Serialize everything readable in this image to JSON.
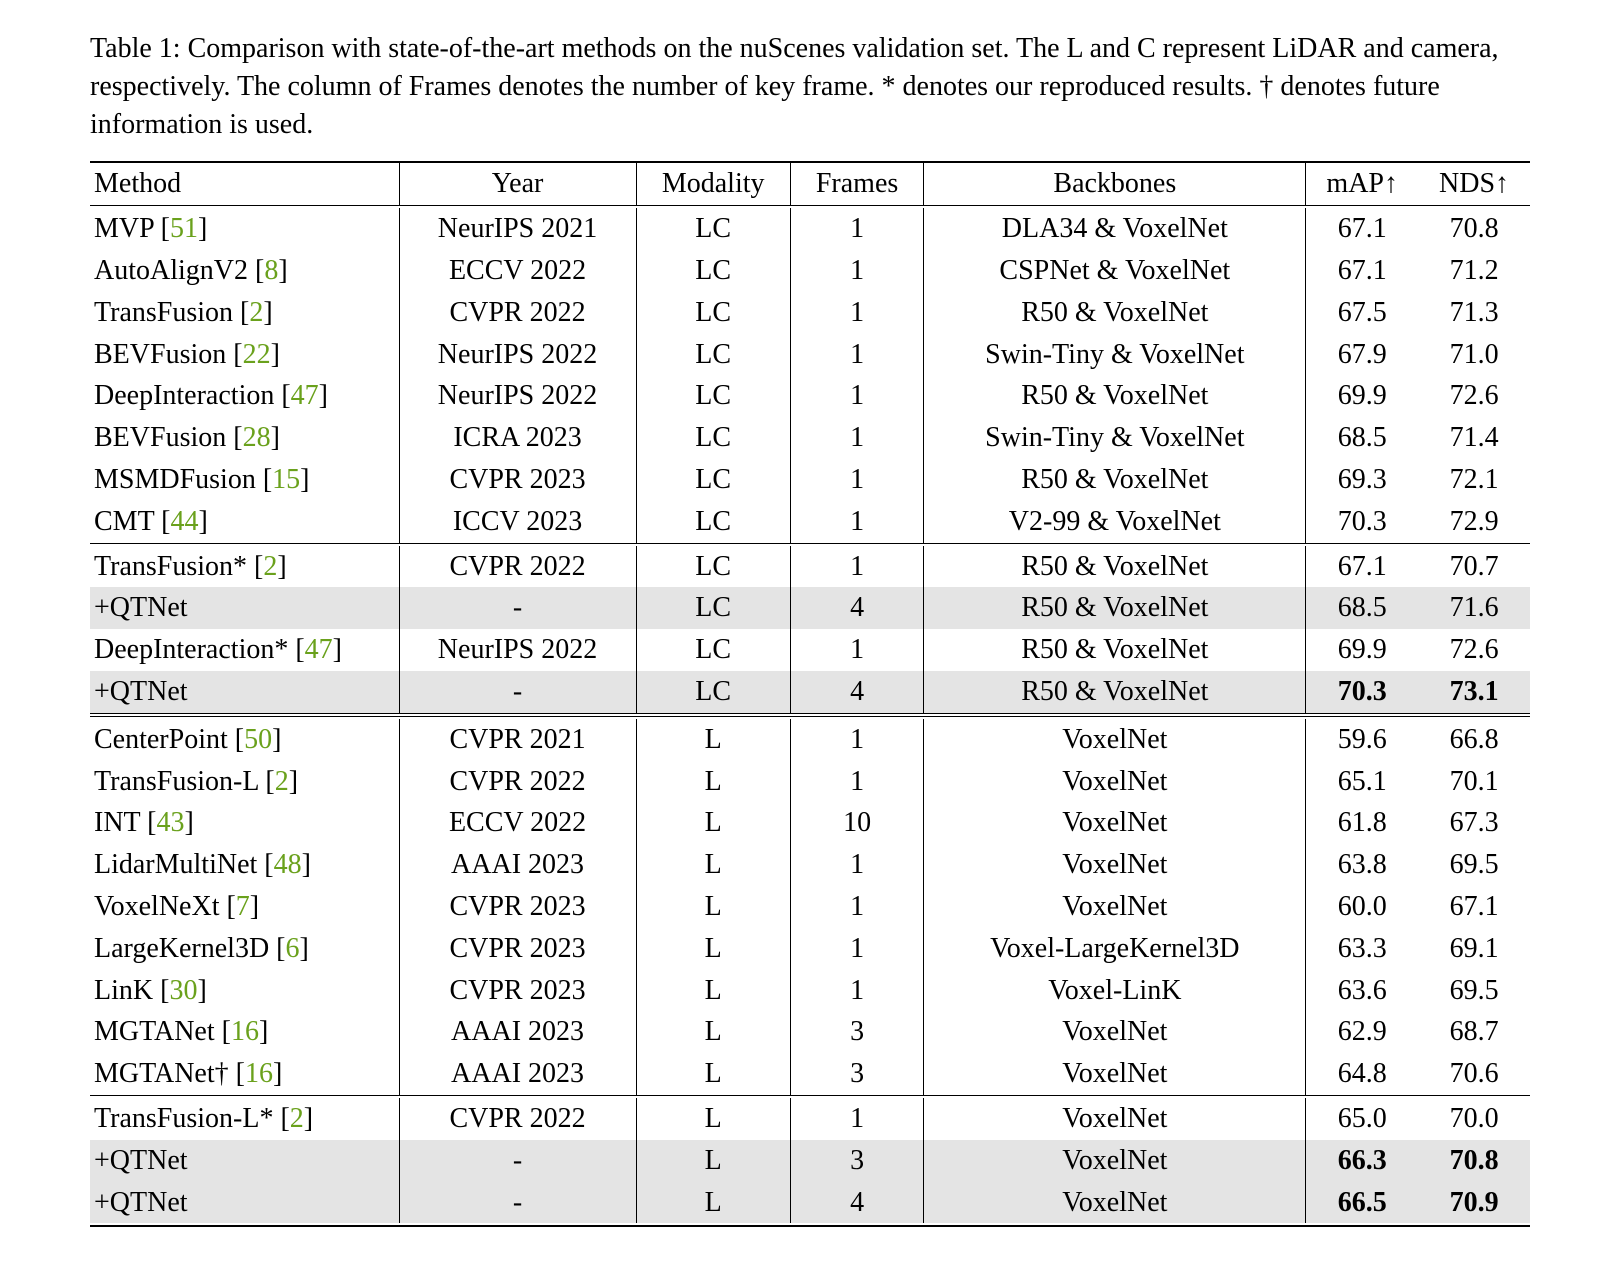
{
  "caption": "Table 1: Comparison with state-of-the-art methods on the nuScenes validation set. The L and C represent LiDAR and camera, respectively. The column of Frames denotes the number of key frame. * denotes our reproduced results. † denotes future information is used.",
  "headers": {
    "method": "Method",
    "year": "Year",
    "modality": "Modality",
    "frames": "Frames",
    "backbones": "Backbones",
    "map": "mAP↑",
    "nds": "NDS↑"
  },
  "chart_data": {
    "type": "table",
    "columns": [
      "Method",
      "Year",
      "Modality",
      "Frames",
      "Backbones",
      "mAP↑",
      "NDS↑"
    ],
    "groups": [
      {
        "rows": [
          {
            "method": "MVP",
            "cite": "51",
            "year": "NeurIPS 2021",
            "modality": "LC",
            "frames": "1",
            "backbones": "DLA34 & VoxelNet",
            "map": "67.1",
            "nds": "70.8"
          },
          {
            "method": "AutoAlignV2",
            "cite": "8",
            "year": "ECCV 2022",
            "modality": "LC",
            "frames": "1",
            "backbones": "CSPNet & VoxelNet",
            "map": "67.1",
            "nds": "71.2"
          },
          {
            "method": "TransFusion",
            "cite": "2",
            "year": "CVPR 2022",
            "modality": "LC",
            "frames": "1",
            "backbones": "R50 & VoxelNet",
            "map": "67.5",
            "nds": "71.3"
          },
          {
            "method": "BEVFusion",
            "cite": "22",
            "year": "NeurIPS 2022",
            "modality": "LC",
            "frames": "1",
            "backbones": "Swin-Tiny & VoxelNet",
            "map": "67.9",
            "nds": "71.0"
          },
          {
            "method": "DeepInteraction",
            "cite": "47",
            "year": "NeurIPS 2022",
            "modality": "LC",
            "frames": "1",
            "backbones": "R50 & VoxelNet",
            "map": "69.9",
            "nds": "72.6"
          },
          {
            "method": "BEVFusion",
            "cite": "28",
            "year": "ICRA 2023",
            "modality": "LC",
            "frames": "1",
            "backbones": "Swin-Tiny & VoxelNet",
            "map": "68.5",
            "nds": "71.4"
          },
          {
            "method": "MSMDFusion",
            "cite": "15",
            "year": "CVPR 2023",
            "modality": "LC",
            "frames": "1",
            "backbones": "R50 & VoxelNet",
            "map": "69.3",
            "nds": "72.1"
          },
          {
            "method": "CMT",
            "cite": "44",
            "year": "ICCV 2023",
            "modality": "LC",
            "frames": "1",
            "backbones": "V2-99 & VoxelNet",
            "map": "70.3",
            "nds": "72.9"
          }
        ]
      },
      {
        "rows": [
          {
            "method": "TransFusion*",
            "cite": "2",
            "year": "CVPR 2022",
            "modality": "LC",
            "frames": "1",
            "backbones": "R50 & VoxelNet",
            "map": "67.1",
            "nds": "70.7"
          },
          {
            "method": "+QTNet",
            "cite": "",
            "year": "-",
            "modality": "LC",
            "frames": "4",
            "backbones": "R50 & VoxelNet",
            "map": "68.5",
            "nds": "71.6",
            "shade": true
          },
          {
            "method": "DeepInteraction*",
            "cite": "47",
            "year": "NeurIPS 2022",
            "modality": "LC",
            "frames": "1",
            "backbones": "R50 & VoxelNet",
            "map": "69.9",
            "nds": "72.6"
          },
          {
            "method": "+QTNet",
            "cite": "",
            "year": "-",
            "modality": "LC",
            "frames": "4",
            "backbones": "R50 & VoxelNet",
            "map": "70.3",
            "map_bold": true,
            "nds": "73.1",
            "nds_bold": true,
            "shade": true
          }
        ]
      },
      {
        "double_rule": true,
        "rows": [
          {
            "method": "CenterPoint",
            "cite": "50",
            "year": "CVPR 2021",
            "modality": "L",
            "frames": "1",
            "backbones": "VoxelNet",
            "map": "59.6",
            "nds": "66.8"
          },
          {
            "method": "TransFusion-L",
            "cite": "2",
            "year": "CVPR 2022",
            "modality": "L",
            "frames": "1",
            "backbones": "VoxelNet",
            "map": "65.1",
            "nds": "70.1"
          },
          {
            "method": "INT",
            "cite": "43",
            "year": "ECCV 2022",
            "modality": "L",
            "frames": "10",
            "backbones": "VoxelNet",
            "map": "61.8",
            "nds": "67.3"
          },
          {
            "method": "LidarMultiNet",
            "cite": "48",
            "year": "AAAI 2023",
            "modality": "L",
            "frames": "1",
            "backbones": "VoxelNet",
            "map": "63.8",
            "nds": "69.5"
          },
          {
            "method": "VoxelNeXt",
            "cite": "7",
            "year": "CVPR 2023",
            "modality": "L",
            "frames": "1",
            "backbones": "VoxelNet",
            "map": "60.0",
            "nds": "67.1"
          },
          {
            "method": "LargeKernel3D",
            "cite": "6",
            "year": "CVPR 2023",
            "modality": "L",
            "frames": "1",
            "backbones": "Voxel-LargeKernel3D",
            "map": "63.3",
            "nds": "69.1"
          },
          {
            "method": "LinK",
            "cite": "30",
            "year": "CVPR 2023",
            "modality": "L",
            "frames": "1",
            "backbones": "Voxel-LinK",
            "map": "63.6",
            "nds": "69.5"
          },
          {
            "method": "MGTANet",
            "cite": "16",
            "year": "AAAI 2023",
            "modality": "L",
            "frames": "3",
            "backbones": "VoxelNet",
            "map": "62.9",
            "nds": "68.7"
          },
          {
            "method": "MGTANet†",
            "cite": "16",
            "year": "AAAI 2023",
            "modality": "L",
            "frames": "3",
            "backbones": "VoxelNet",
            "map": "64.8",
            "nds": "70.6"
          }
        ]
      },
      {
        "rows": [
          {
            "method": "TransFusion-L*",
            "cite": "2",
            "year": "CVPR 2022",
            "modality": "L",
            "frames": "1",
            "backbones": "VoxelNet",
            "map": "65.0",
            "nds": "70.0"
          },
          {
            "method": "+QTNet",
            "cite": "",
            "year": "-",
            "modality": "L",
            "frames": "3",
            "backbones": "VoxelNet",
            "map": "66.3",
            "map_bold": true,
            "nds": "70.8",
            "nds_bold": true,
            "shade": true
          },
          {
            "method": "+QTNet",
            "cite": "",
            "year": "-",
            "modality": "L",
            "frames": "4",
            "backbones": "VoxelNet",
            "map": "66.5",
            "map_bold": true,
            "nds": "70.9",
            "nds_bold": true,
            "shade": true
          }
        ]
      }
    ]
  }
}
